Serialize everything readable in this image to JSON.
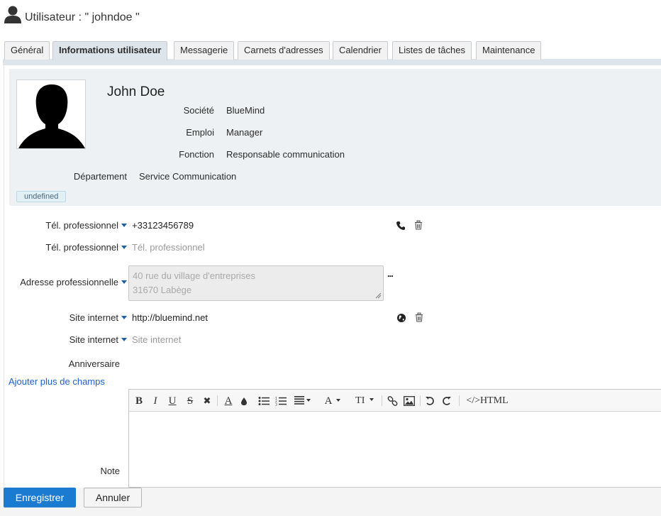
{
  "header": {
    "title": "Utilisateur : \" johndoe \""
  },
  "tabs": [
    {
      "label": "Général",
      "active": false
    },
    {
      "label": "Informations utilisateur",
      "active": true
    },
    {
      "label": "Messagerie",
      "active": false
    },
    {
      "label": "Carnets d'adresses",
      "active": false
    },
    {
      "label": "Calendrier",
      "active": false
    },
    {
      "label": "Listes de tâches",
      "active": false
    },
    {
      "label": "Maintenance",
      "active": false
    }
  ],
  "card": {
    "fullname": "John Doe",
    "company_label": "Société",
    "company": "BlueMind",
    "job_label": "Emploi",
    "job": "Manager",
    "role_label": "Fonction",
    "role": "Responsable communication",
    "department_label": "Département",
    "department": "Service Communication",
    "badge": "undefined"
  },
  "fields": {
    "phone1": {
      "label": "Tél. professionnel",
      "value": "+33123456789"
    },
    "phone2": {
      "label": "Tél. professionnel",
      "placeholder": "Tél. professionnel"
    },
    "address": {
      "label": "Adresse professionnelle",
      "line1": "40 rue du village d'entreprises",
      "line2": "31670 Labège"
    },
    "address_more": "...",
    "website1": {
      "label": "Site internet",
      "value": "http://bluemind.net"
    },
    "website2": {
      "label": "Site internet",
      "placeholder": "Site internet"
    },
    "birthday": {
      "label": "Anniversaire"
    }
  },
  "add_fields_link": "Ajouter plus de champs",
  "note": {
    "label": "Note",
    "toolbar": {
      "bold": "B",
      "italic": "I",
      "underline": "U",
      "strike": "S",
      "clear": "✖",
      "font_color": "A",
      "highlight": "💧",
      "font_family": "A",
      "font_size": "TI",
      "html": "</>HTML"
    }
  },
  "footer": {
    "save": "Enregistrer",
    "cancel": "Annuler"
  },
  "colors": {
    "accent": "#1b7bd0",
    "link": "#1f5fc8",
    "card_bg": "#eef1f3",
    "tab_active_bg": "#dde4ea"
  }
}
